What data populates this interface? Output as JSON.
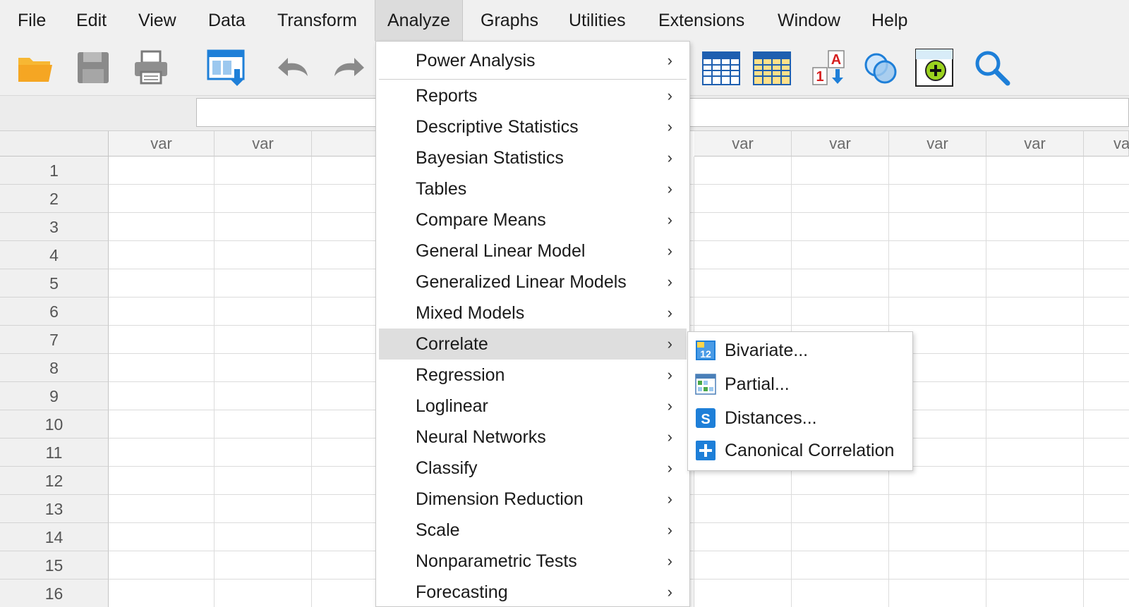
{
  "menubar": {
    "items": [
      "File",
      "Edit",
      "View",
      "Data",
      "Transform",
      "Analyze",
      "Graphs",
      "Utilities",
      "Extensions",
      "Window",
      "Help"
    ],
    "active": "Analyze"
  },
  "toolbar": {
    "icons": [
      "open-folder-icon",
      "save-icon",
      "print-icon",
      "recall-dialog-icon",
      "undo-icon",
      "redo-icon",
      "variables-view-icon",
      "data-view-icon",
      "value-labels-icon",
      "use-sets-icon",
      "add-icon",
      "search-icon"
    ]
  },
  "grid": {
    "col_header_label": "var",
    "col_headers_left": [
      "var",
      "var"
    ],
    "col_headers_right": [
      "var",
      "var",
      "var",
      "var",
      "va"
    ],
    "rows": [
      "1",
      "2",
      "3",
      "4",
      "5",
      "6",
      "7",
      "8",
      "9",
      "10",
      "11",
      "12",
      "13",
      "14",
      "15",
      "16"
    ]
  },
  "analyze_menu": {
    "items": [
      {
        "label": "Power Analysis",
        "has_submenu": true
      },
      {
        "label": "Reports",
        "has_submenu": true
      },
      {
        "label": "Descriptive Statistics",
        "has_submenu": true
      },
      {
        "label": "Bayesian Statistics",
        "has_submenu": true
      },
      {
        "label": "Tables",
        "has_submenu": true
      },
      {
        "label": "Compare Means",
        "has_submenu": true
      },
      {
        "label": "General Linear Model",
        "has_submenu": true
      },
      {
        "label": "Generalized Linear Models",
        "has_submenu": true
      },
      {
        "label": "Mixed Models",
        "has_submenu": true
      },
      {
        "label": "Correlate",
        "has_submenu": true,
        "highlighted": true
      },
      {
        "label": "Regression",
        "has_submenu": true
      },
      {
        "label": "Loglinear",
        "has_submenu": true
      },
      {
        "label": "Neural Networks",
        "has_submenu": true
      },
      {
        "label": "Classify",
        "has_submenu": true
      },
      {
        "label": "Dimension Reduction",
        "has_submenu": true
      },
      {
        "label": "Scale",
        "has_submenu": true
      },
      {
        "label": "Nonparametric Tests",
        "has_submenu": true
      },
      {
        "label": "Forecasting",
        "has_submenu": true
      }
    ],
    "arrow_glyph": "›"
  },
  "correlate_submenu": {
    "items": [
      {
        "label": "Bivariate...",
        "icon": "bivariate-icon"
      },
      {
        "label": "Partial...",
        "icon": "partial-icon"
      },
      {
        "label": "Distances...",
        "icon": "distances-icon"
      },
      {
        "label": "Canonical Correlation",
        "icon": "canonical-correlation-icon"
      }
    ]
  },
  "colors": {
    "menu_highlight": "#dedede",
    "accent_blue": "#1e7fd8",
    "folder_orange": "#f5a623"
  }
}
